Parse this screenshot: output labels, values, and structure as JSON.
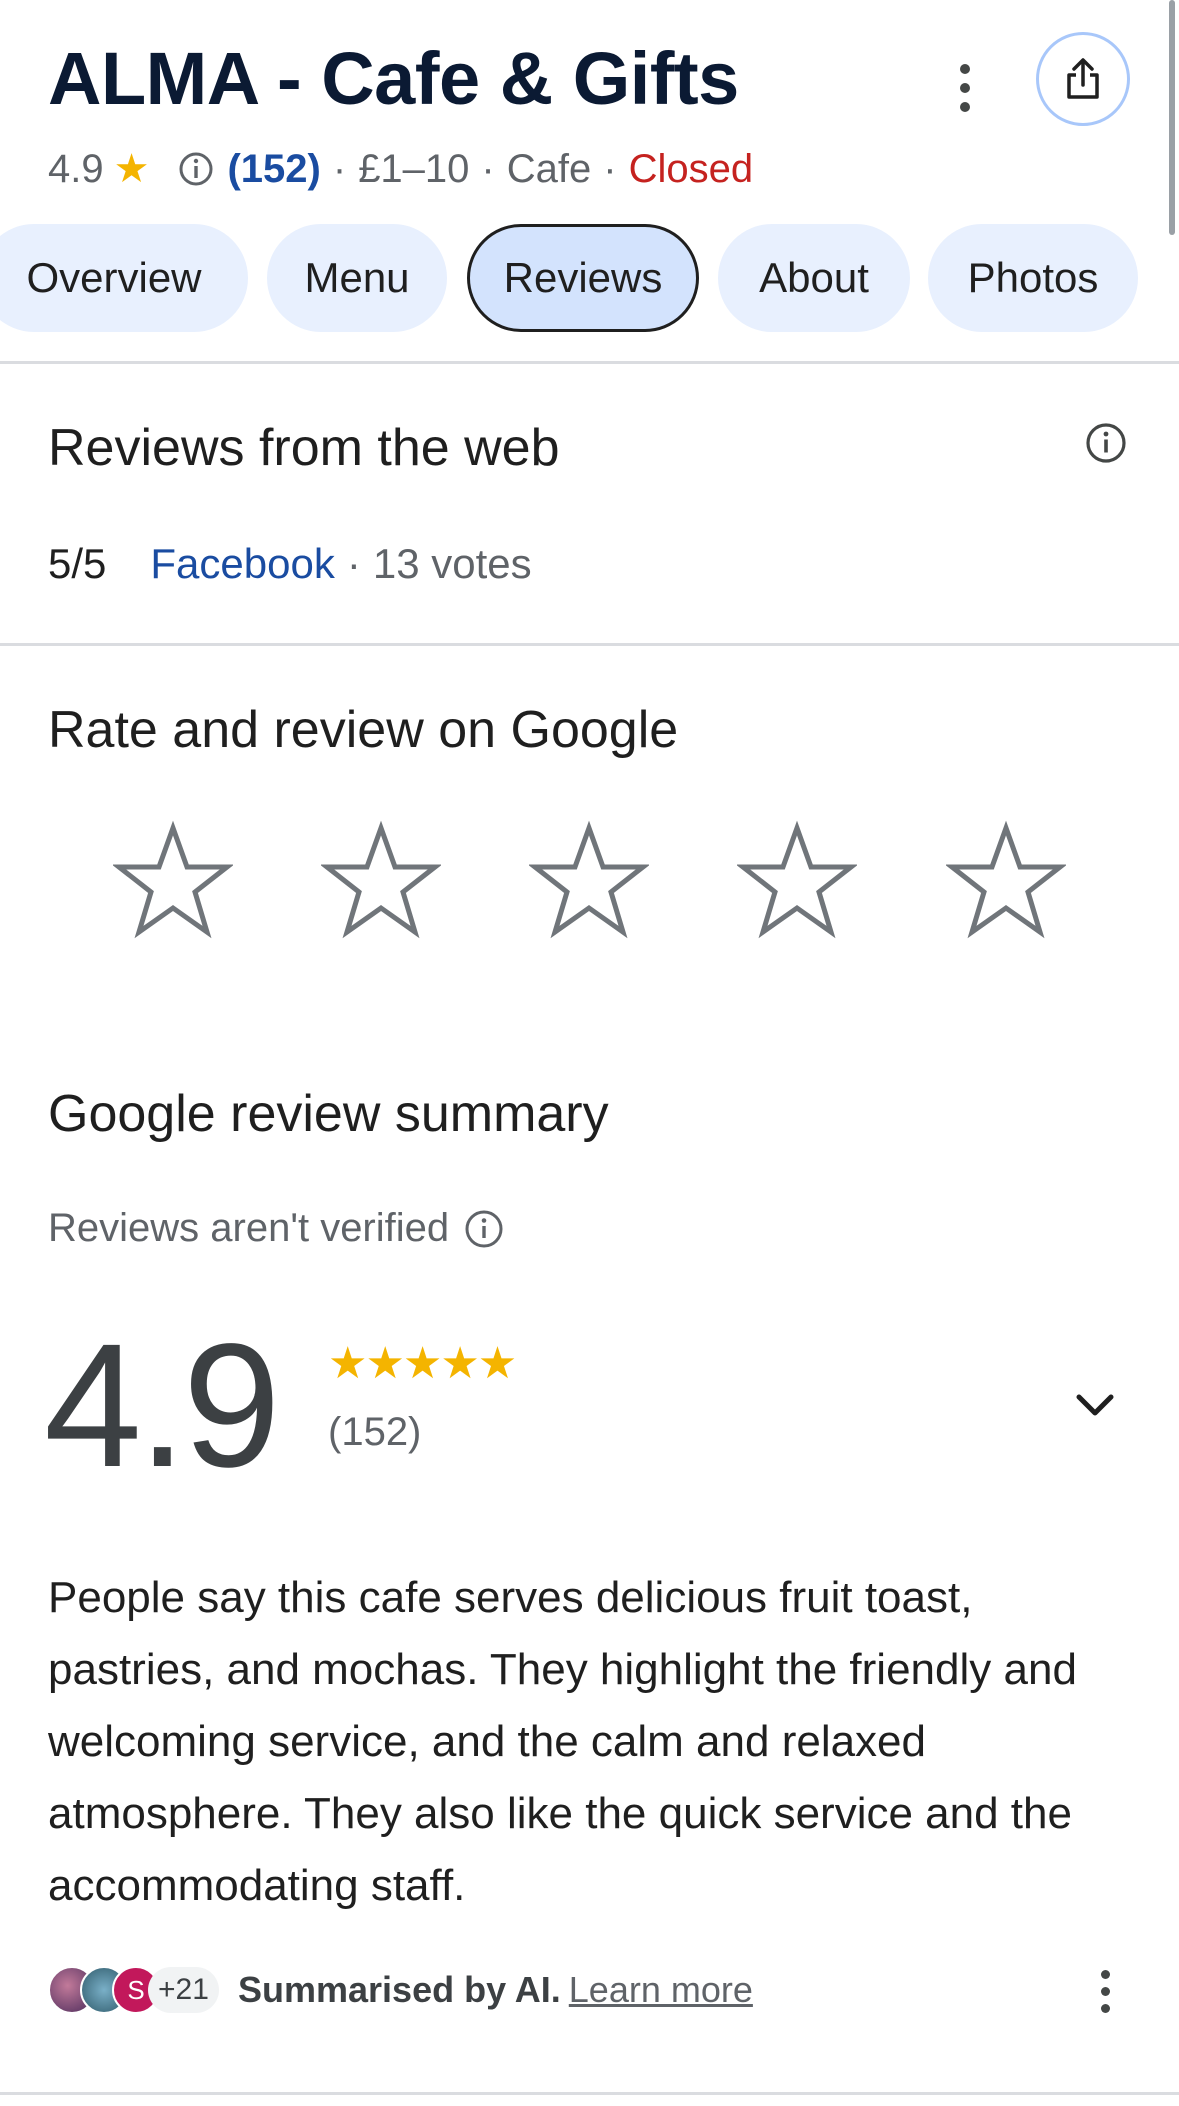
{
  "place": {
    "title": "ALMA - Cafe & Gifts",
    "rating": "4.9",
    "review_count": "(152)",
    "price": "£1–10",
    "category": "Cafe",
    "status": "Closed",
    "separator": "·"
  },
  "tabs": [
    {
      "label": "Overview"
    },
    {
      "label": "Menu"
    },
    {
      "label": "Reviews",
      "active": true
    },
    {
      "label": "About"
    },
    {
      "label": "Photos"
    }
  ],
  "web_reviews": {
    "heading": "Reviews from the web",
    "score": "5/5",
    "source": "Facebook",
    "votes": "13 votes"
  },
  "rate": {
    "heading": "Rate and review on Google",
    "star_count": 5
  },
  "summary": {
    "heading": "Google review summary",
    "unverified": "Reviews aren't verified",
    "rating": "4.9",
    "stars": "★★★★★",
    "count": "(152)",
    "text": "People say this cafe serves delicious fruit toast, pastries, and mochas. They highlight the friendly and welcoming service, and the calm and relaxed atmosphere. They also like the quick service and the accommodating staff.",
    "avatar_letter": "S",
    "more_count": "+21",
    "ai_label": "Summarised by AI.",
    "learn_more": "Learn more"
  },
  "colors": {
    "accent": "#1a4ca1",
    "star": "#f4b400",
    "closed": "#c5221f",
    "tab_bg": "#e8f0fe",
    "tab_active_bg": "#d3e3fd"
  },
  "icons": {
    "menu": "more-vert-icon",
    "share": "share-icon",
    "info": "info-icon",
    "rate_star": "star-outline-icon",
    "expand": "chevron-down-icon"
  }
}
